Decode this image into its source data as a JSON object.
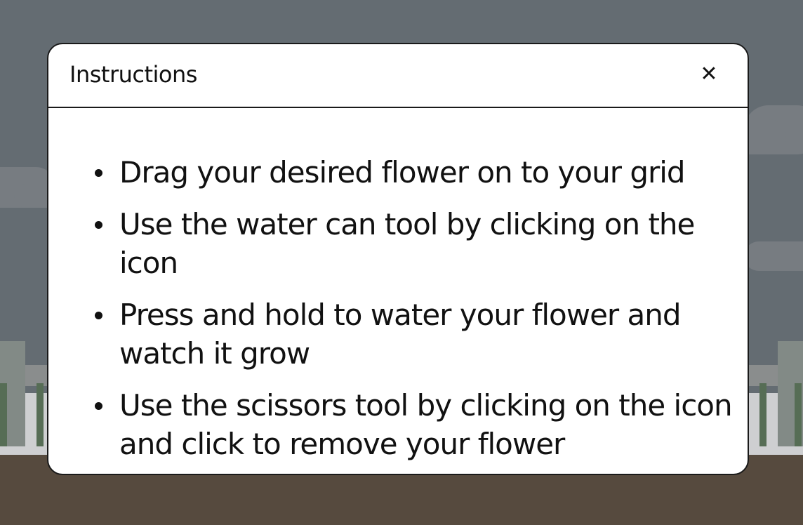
{
  "modal": {
    "title": "Instructions",
    "close_icon": "close-icon",
    "close_glyph": "✕",
    "items": [
      "Drag your desired flower on to your grid",
      "Use the water can tool by clicking on the icon",
      "Press and hold to water your flower and watch it grow",
      "Use the scissors tool by clicking on the icon and click to remove your flower"
    ]
  },
  "colors": {
    "sky": "#727b80",
    "ground": "#5f4e3b",
    "modal_bg": "#ffffff",
    "text": "#111111"
  }
}
